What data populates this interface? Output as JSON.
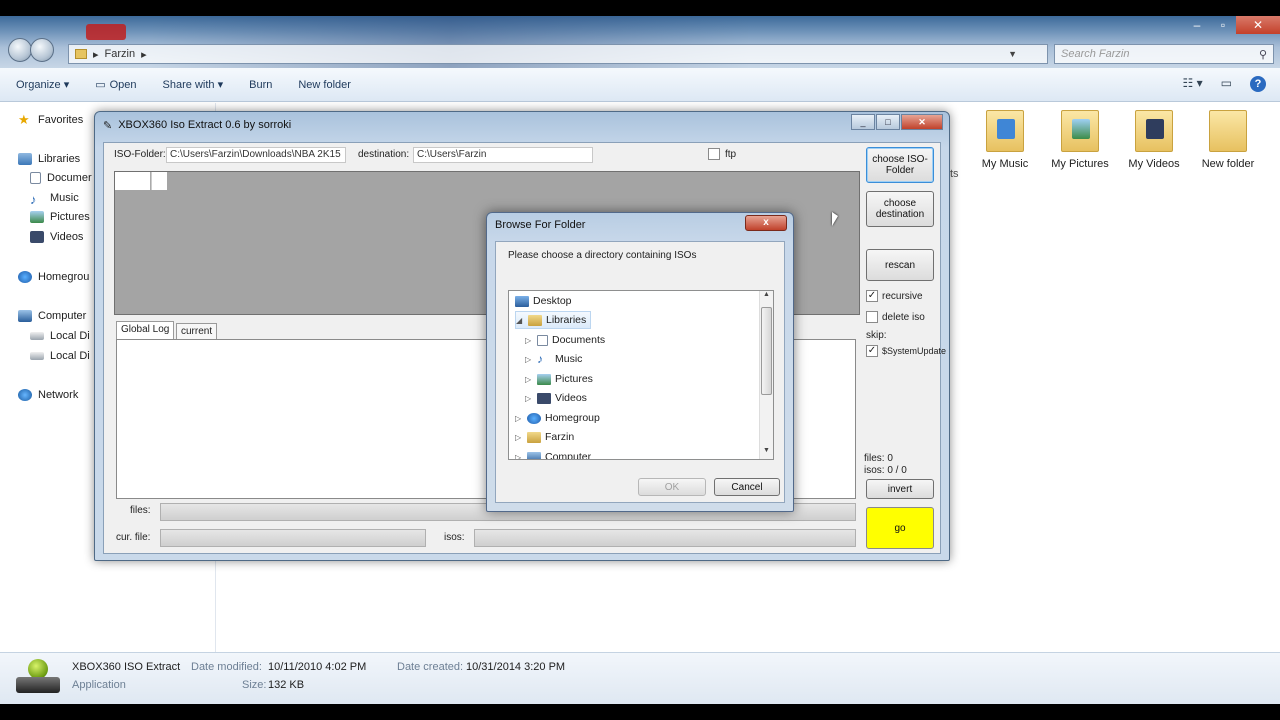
{
  "explorer": {
    "address_path": "Farzin",
    "search_placeholder": "Search Farzin",
    "toolbar": {
      "organize": "Organize ▾",
      "open": "Open",
      "share_with": "Share with ▾",
      "burn": "Burn",
      "new_folder": "New folder"
    },
    "nav": {
      "favorites": "Favorites",
      "libraries": "Libraries",
      "documents": "Documer",
      "music": "Music",
      "pictures": "Pictures",
      "videos": "Videos",
      "homegroup": "Homegrou",
      "computer": "Computer",
      "local_disk_1": "Local Di",
      "local_disk_2": "Local Di",
      "network": "Network"
    },
    "folders": [
      {
        "label": "My Music",
        "icon": "music-folder-icon"
      },
      {
        "label": "My Pictures",
        "icon": "pictures-folder-icon"
      },
      {
        "label": "My Videos",
        "icon": "videos-folder-icon"
      },
      {
        "label": "New folder",
        "icon": "folder-icon"
      }
    ],
    "stray_text": "ts",
    "details": {
      "name": "XBOX360 ISO Extract",
      "type": "Application",
      "date_modified_label": "Date modified:",
      "date_modified": "10/11/2010 4:02 PM",
      "date_created_label": "Date created:",
      "date_created": "10/31/2014 3:20 PM",
      "size_label": "Size:",
      "size": "132 KB"
    }
  },
  "xbox_window": {
    "title": "XBOX360 Iso Extract 0.6 by sorroki",
    "iso_folder_label": "ISO-Folder:",
    "iso_folder_value": "C:\\Users\\Farzin\\Downloads\\NBA 2K15",
    "destination_label": "destination:",
    "destination_value": "C:\\Users\\Farzin",
    "ftp_label": "ftp",
    "tabs": [
      "Global Log",
      "current"
    ],
    "files_label": "files:",
    "cur_file_label": "cur. file:",
    "isos_label": "isos:",
    "buttons": {
      "choose_iso": "choose ISO-Folder",
      "choose_destination": "choose destination",
      "rescan": "rescan",
      "invert": "invert",
      "go": "go"
    },
    "recursive_label": "recursive",
    "delete_iso_label": "delete iso",
    "skip_label": "skip:",
    "skip_item": "$SystemUpdate",
    "files_count": "files: 0",
    "isos_count": "isos: 0 / 0"
  },
  "browse_dialog": {
    "title": "Browse For Folder",
    "prompt": "Please choose a directory containing ISOs",
    "tree": [
      "Desktop",
      "Libraries",
      "Documents",
      "Music",
      "Pictures",
      "Videos",
      "Homegroup",
      "Farzin",
      "Computer"
    ],
    "ok": "OK",
    "cancel": "Cancel",
    "close": "x"
  }
}
